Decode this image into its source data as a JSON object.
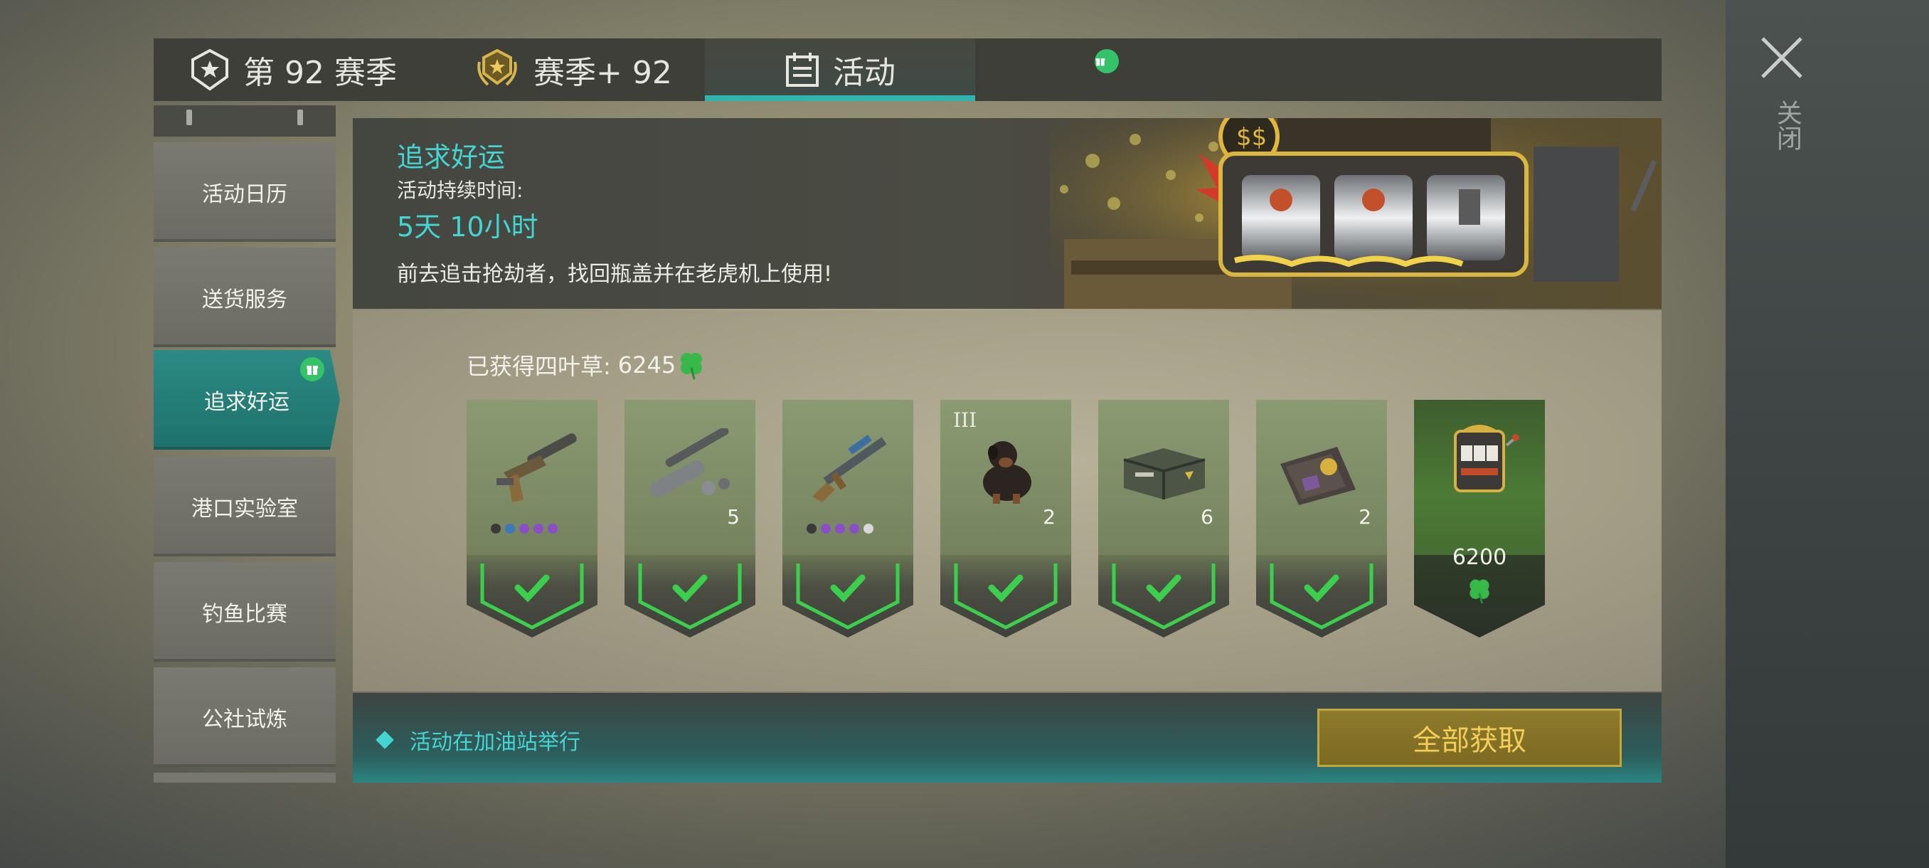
{
  "window": {
    "close_label": "关闭"
  },
  "tabs": [
    {
      "label": "第 92 赛季",
      "icon": "shield-star-icon"
    },
    {
      "label": "赛季+ 92",
      "icon": "gold-laurel-badge-icon"
    },
    {
      "label": "活动",
      "icon": "calendar-icon",
      "active": true,
      "badge": "gift-icon"
    }
  ],
  "sidebar": {
    "items": [
      {
        "label": "活动日历"
      },
      {
        "label": "送货服务"
      },
      {
        "label": "追求好运",
        "active": true,
        "badge": "gift-icon"
      },
      {
        "label": "港口实验室"
      },
      {
        "label": "钓鱼比赛"
      },
      {
        "label": "公社试炼"
      }
    ]
  },
  "event": {
    "title": "追求好运",
    "duration_label": "活动持续时间:",
    "duration_value": "5天 10小时",
    "description": "前去追击抢劫者，找回瓶盖并在老虎机上使用!"
  },
  "clovers": {
    "label": "已获得四叶草:",
    "count": "6245",
    "icon": "four-leaf-clover-icon"
  },
  "rewards": [
    {
      "icon": "silenced-pistol-icon",
      "qty": "",
      "claimed": true,
      "rarity_dots": [
        "#3a3a3a",
        "#3d78b8",
        "#8a4fc7",
        "#8a4fc7",
        "#8a4fc7"
      ]
    },
    {
      "icon": "rocket-launcher-parts-icon",
      "qty": "5",
      "claimed": true
    },
    {
      "icon": "assault-rifle-icon",
      "qty": "",
      "claimed": true,
      "rarity_dots": [
        "#3a3a3a",
        "#8a4fc7",
        "#8a4fc7",
        "#8a4fc7",
        "#d8d8d8"
      ]
    },
    {
      "icon": "rottweiler-dog-icon",
      "qty": "2",
      "tier": "III",
      "claimed": true
    },
    {
      "icon": "military-crate-icon",
      "qty": "6",
      "claimed": true
    },
    {
      "icon": "badge-wallet-icon",
      "qty": "2",
      "claimed": true
    },
    {
      "icon": "slot-machine-icon",
      "cost": "6200",
      "cost_icon": "four-leaf-clover-icon",
      "claimed": false
    }
  ],
  "footer": {
    "note": "活动在加油站举行",
    "claim_all_label": "全部获取"
  },
  "colors": {
    "accent_teal": "#44d4d2",
    "tab_active": "#2fb5b0",
    "check_green": "#3ccf4e",
    "button_gold": "#c2a63e",
    "badge_green": "#35c268"
  }
}
